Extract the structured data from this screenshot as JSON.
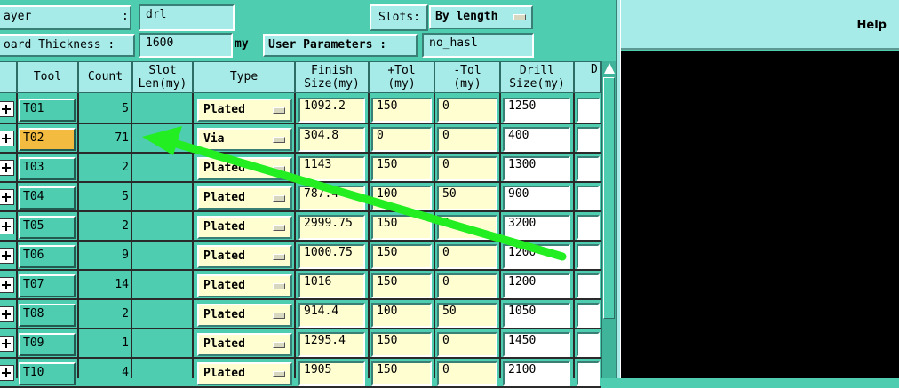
{
  "form": {
    "layer_label": "ayer             :",
    "layer_value": "drl",
    "slots_label": "Slots:",
    "slots_value": "By length",
    "board_thickness_label": "oard Thickness :",
    "board_thickness_value": "1600",
    "board_thickness_unit": "my",
    "user_params_label": "User Parameters :",
    "user_params_value": "no_hasl"
  },
  "right_panel": {
    "help_label": "Help"
  },
  "table": {
    "headers": {
      "tool": "Tool",
      "count": "Count",
      "slot_len": "Slot\nLen(my)",
      "type": "Type",
      "finish": "Finish\nSize(my)",
      "plus_tol": "+Tol\n(my)",
      "minus_tol": "-Tol\n(my)",
      "drill": "Drill\nSize(my)",
      "next": "D"
    },
    "rows": [
      {
        "tool": "T01",
        "count": "5",
        "type": "Plated",
        "finish": "1092.2",
        "ptol": "150",
        "mtol": "0",
        "drill": "1250",
        "selected": false
      },
      {
        "tool": "T02",
        "count": "71",
        "type": "Via",
        "finish": "304.8",
        "ptol": "0",
        "mtol": "0",
        "drill": "400",
        "selected": true
      },
      {
        "tool": "T03",
        "count": "2",
        "type": "Plated",
        "finish": "1143",
        "ptol": "150",
        "mtol": "0",
        "drill": "1300",
        "selected": false
      },
      {
        "tool": "T04",
        "count": "5",
        "type": "Plated",
        "finish": "787.4",
        "ptol": "100",
        "mtol": "50",
        "drill": "900",
        "selected": false
      },
      {
        "tool": "T05",
        "count": "2",
        "type": "Plated",
        "finish": "2999.75",
        "ptol": "150",
        "mtol": "0",
        "drill": "3200",
        "selected": false
      },
      {
        "tool": "T06",
        "count": "9",
        "type": "Plated",
        "finish": "1000.75",
        "ptol": "150",
        "mtol": "0",
        "drill": "1200",
        "selected": false
      },
      {
        "tool": "T07",
        "count": "14",
        "type": "Plated",
        "finish": "1016",
        "ptol": "150",
        "mtol": "0",
        "drill": "1200",
        "selected": false
      },
      {
        "tool": "T08",
        "count": "2",
        "type": "Plated",
        "finish": "914.4",
        "ptol": "100",
        "mtol": "50",
        "drill": "1050",
        "selected": false
      },
      {
        "tool": "T09",
        "count": "1",
        "type": "Plated",
        "finish": "1295.4",
        "ptol": "150",
        "mtol": "0",
        "drill": "1450",
        "selected": false
      },
      {
        "tool": "T10",
        "count": "4",
        "type": "Plated",
        "finish": "1905",
        "ptol": "150",
        "mtol": "0",
        "drill": "2100",
        "selected": false
      }
    ]
  },
  "annotation": {
    "arrow_color": "#22ee22"
  }
}
